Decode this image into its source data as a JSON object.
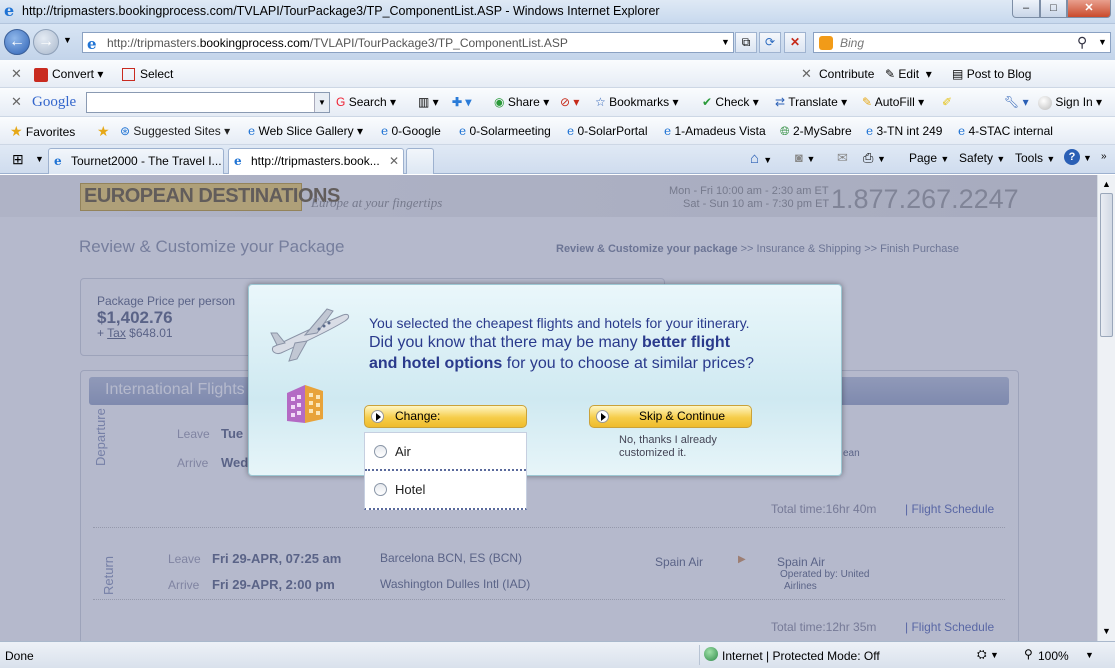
{
  "window": {
    "title": "http://tripmasters.bookingprocess.com/TVLAPI/TourPackage3/TP_ComponentList.ASP - Windows Internet Explorer"
  },
  "address": {
    "url_prefix": "http://tripmasters.",
    "url_domain": "bookingprocess.com",
    "url_path": "/TVLAPI/TourPackage3/TP_ComponentList.ASP",
    "search_placeholder": "Bing"
  },
  "convert_bar": {
    "convert": "Convert",
    "select": "Select",
    "contribute": "Contribute",
    "edit": "Edit",
    "post_to_blog": "Post to Blog"
  },
  "google_bar": {
    "logo": "Google",
    "search": "Search",
    "share": "Share",
    "bookmarks": "Bookmarks",
    "check": "Check",
    "translate": "Translate",
    "autofill": "AutoFill",
    "sign_in": "Sign In"
  },
  "favorites_bar": {
    "favorites": "Favorites",
    "items": [
      "Suggested Sites",
      "Web Slice Gallery",
      "0-Google",
      "0-Solarmeeting",
      "0-SolarPortal",
      "1-Amadeus Vista",
      "2-MySabre",
      "3-TN int 249",
      "4-STAC internal"
    ]
  },
  "tabs": [
    {
      "label": "Tournet2000 - The Travel I..."
    },
    {
      "label": "http://tripmasters.book..."
    }
  ],
  "command_bar": {
    "page": "Page",
    "safety": "Safety",
    "tools": "Tools"
  },
  "site": {
    "logo": "EUROPEAN DESTINATIONS",
    "tagline": "Europe at your fingertips",
    "hours1": "Mon - Fri 10:00 am - 2:30 am ET",
    "hours2": "Sat - Sun 10 am - 7:30 pm ET",
    "phone": "1.877.267.2247",
    "page_title": "Review & Customize your Package",
    "steps": {
      "s1": "Review & Customize your package",
      "sep": ">>",
      "s2": "Insurance & Shipping",
      "s3": "Finish Purchase"
    },
    "price_label": "Package Price per person",
    "price": "$1,402.76",
    "tax_prefix": "+",
    "tax_label": "Tax",
    "tax_value": "$648.01",
    "section_title": "International Flights",
    "departure": {
      "label": "Departure",
      "leave": "Leave",
      "leave_val": "Tue",
      "arrive": "Arrive",
      "arrive_val": "Wed",
      "airline_tail": "ean",
      "total": "Total time:16hr 40m",
      "schedule": "Flight Schedule"
    },
    "return": {
      "label": "Return",
      "leave": "Leave",
      "leave_val": "Fri 29-APR, 07:25 am",
      "leave_place": "Barcelona BCN, ES (BCN)",
      "arrive": "Arrive",
      "arrive_val": "Fri 29-APR, 2:00 pm",
      "arrive_place": "Washington Dulles Intl (IAD)",
      "airline": "Spain Air",
      "airline2": "Spain Air",
      "operated1": "Operated by: United",
      "operated2": "Airlines",
      "total": "Total time:12hr 35m",
      "schedule": "Flight Schedule"
    }
  },
  "modal": {
    "line1": "You selected the cheapest flights and hotels for your itinerary.",
    "line2a": "Did you know that there may be many",
    "line2b": "better flight",
    "line3a": "and hotel options",
    "line3b": "for you to choose at similar prices?",
    "change": "Change:",
    "skip": "Skip & Continue",
    "skip_note1": "No, thanks I already",
    "skip_note2": "customized it.",
    "options": [
      "Air",
      "Hotel"
    ]
  },
  "status": {
    "left": "Done",
    "zone": "Internet | Protected Mode: Off",
    "zoom": "100%"
  }
}
